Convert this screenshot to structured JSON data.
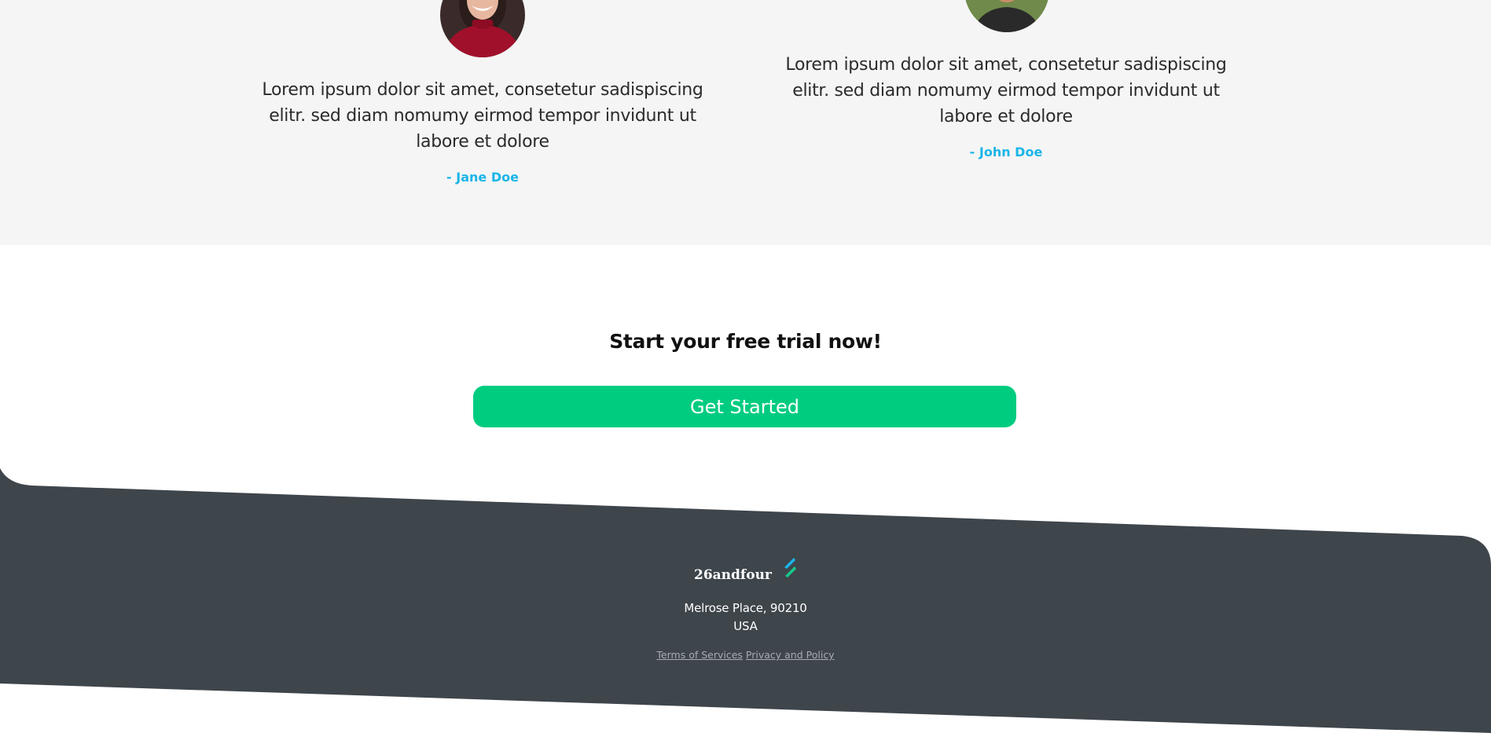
{
  "testimonials": [
    {
      "quote": "Lorem ipsum dolor sit amet, consetetur sadispiscing elitr. sed diam nomumy eirmod tempor invidunt ut labore et dolore",
      "author": "- Jane Doe",
      "avatar": "woman-portrait"
    },
    {
      "quote": "Lorem ipsum dolor sit amet, consetetur sadispiscing elitr. sed diam nomumy eirmod tempor invidunt ut labore et dolore",
      "author": "- John Doe",
      "avatar": "man-portrait"
    }
  ],
  "cta": {
    "heading": "Start your free trial now!",
    "button_label": "Get Started"
  },
  "footer": {
    "brand": "26andfour",
    "brand_icon": "lightning-bolt-icon",
    "address_line1": "Melrose Place, 90210",
    "address_line2": "USA",
    "links": {
      "terms": "Terms of Services",
      "privacy": "Privacy and Policy"
    }
  },
  "colors": {
    "accent": "#1ab5e8",
    "cta": "#00cc80",
    "footer_bg": "#3e454b",
    "section_bg": "#f5f5f5",
    "brand_mark_blue": "#1ab5e8",
    "brand_mark_green": "#16c98c"
  }
}
